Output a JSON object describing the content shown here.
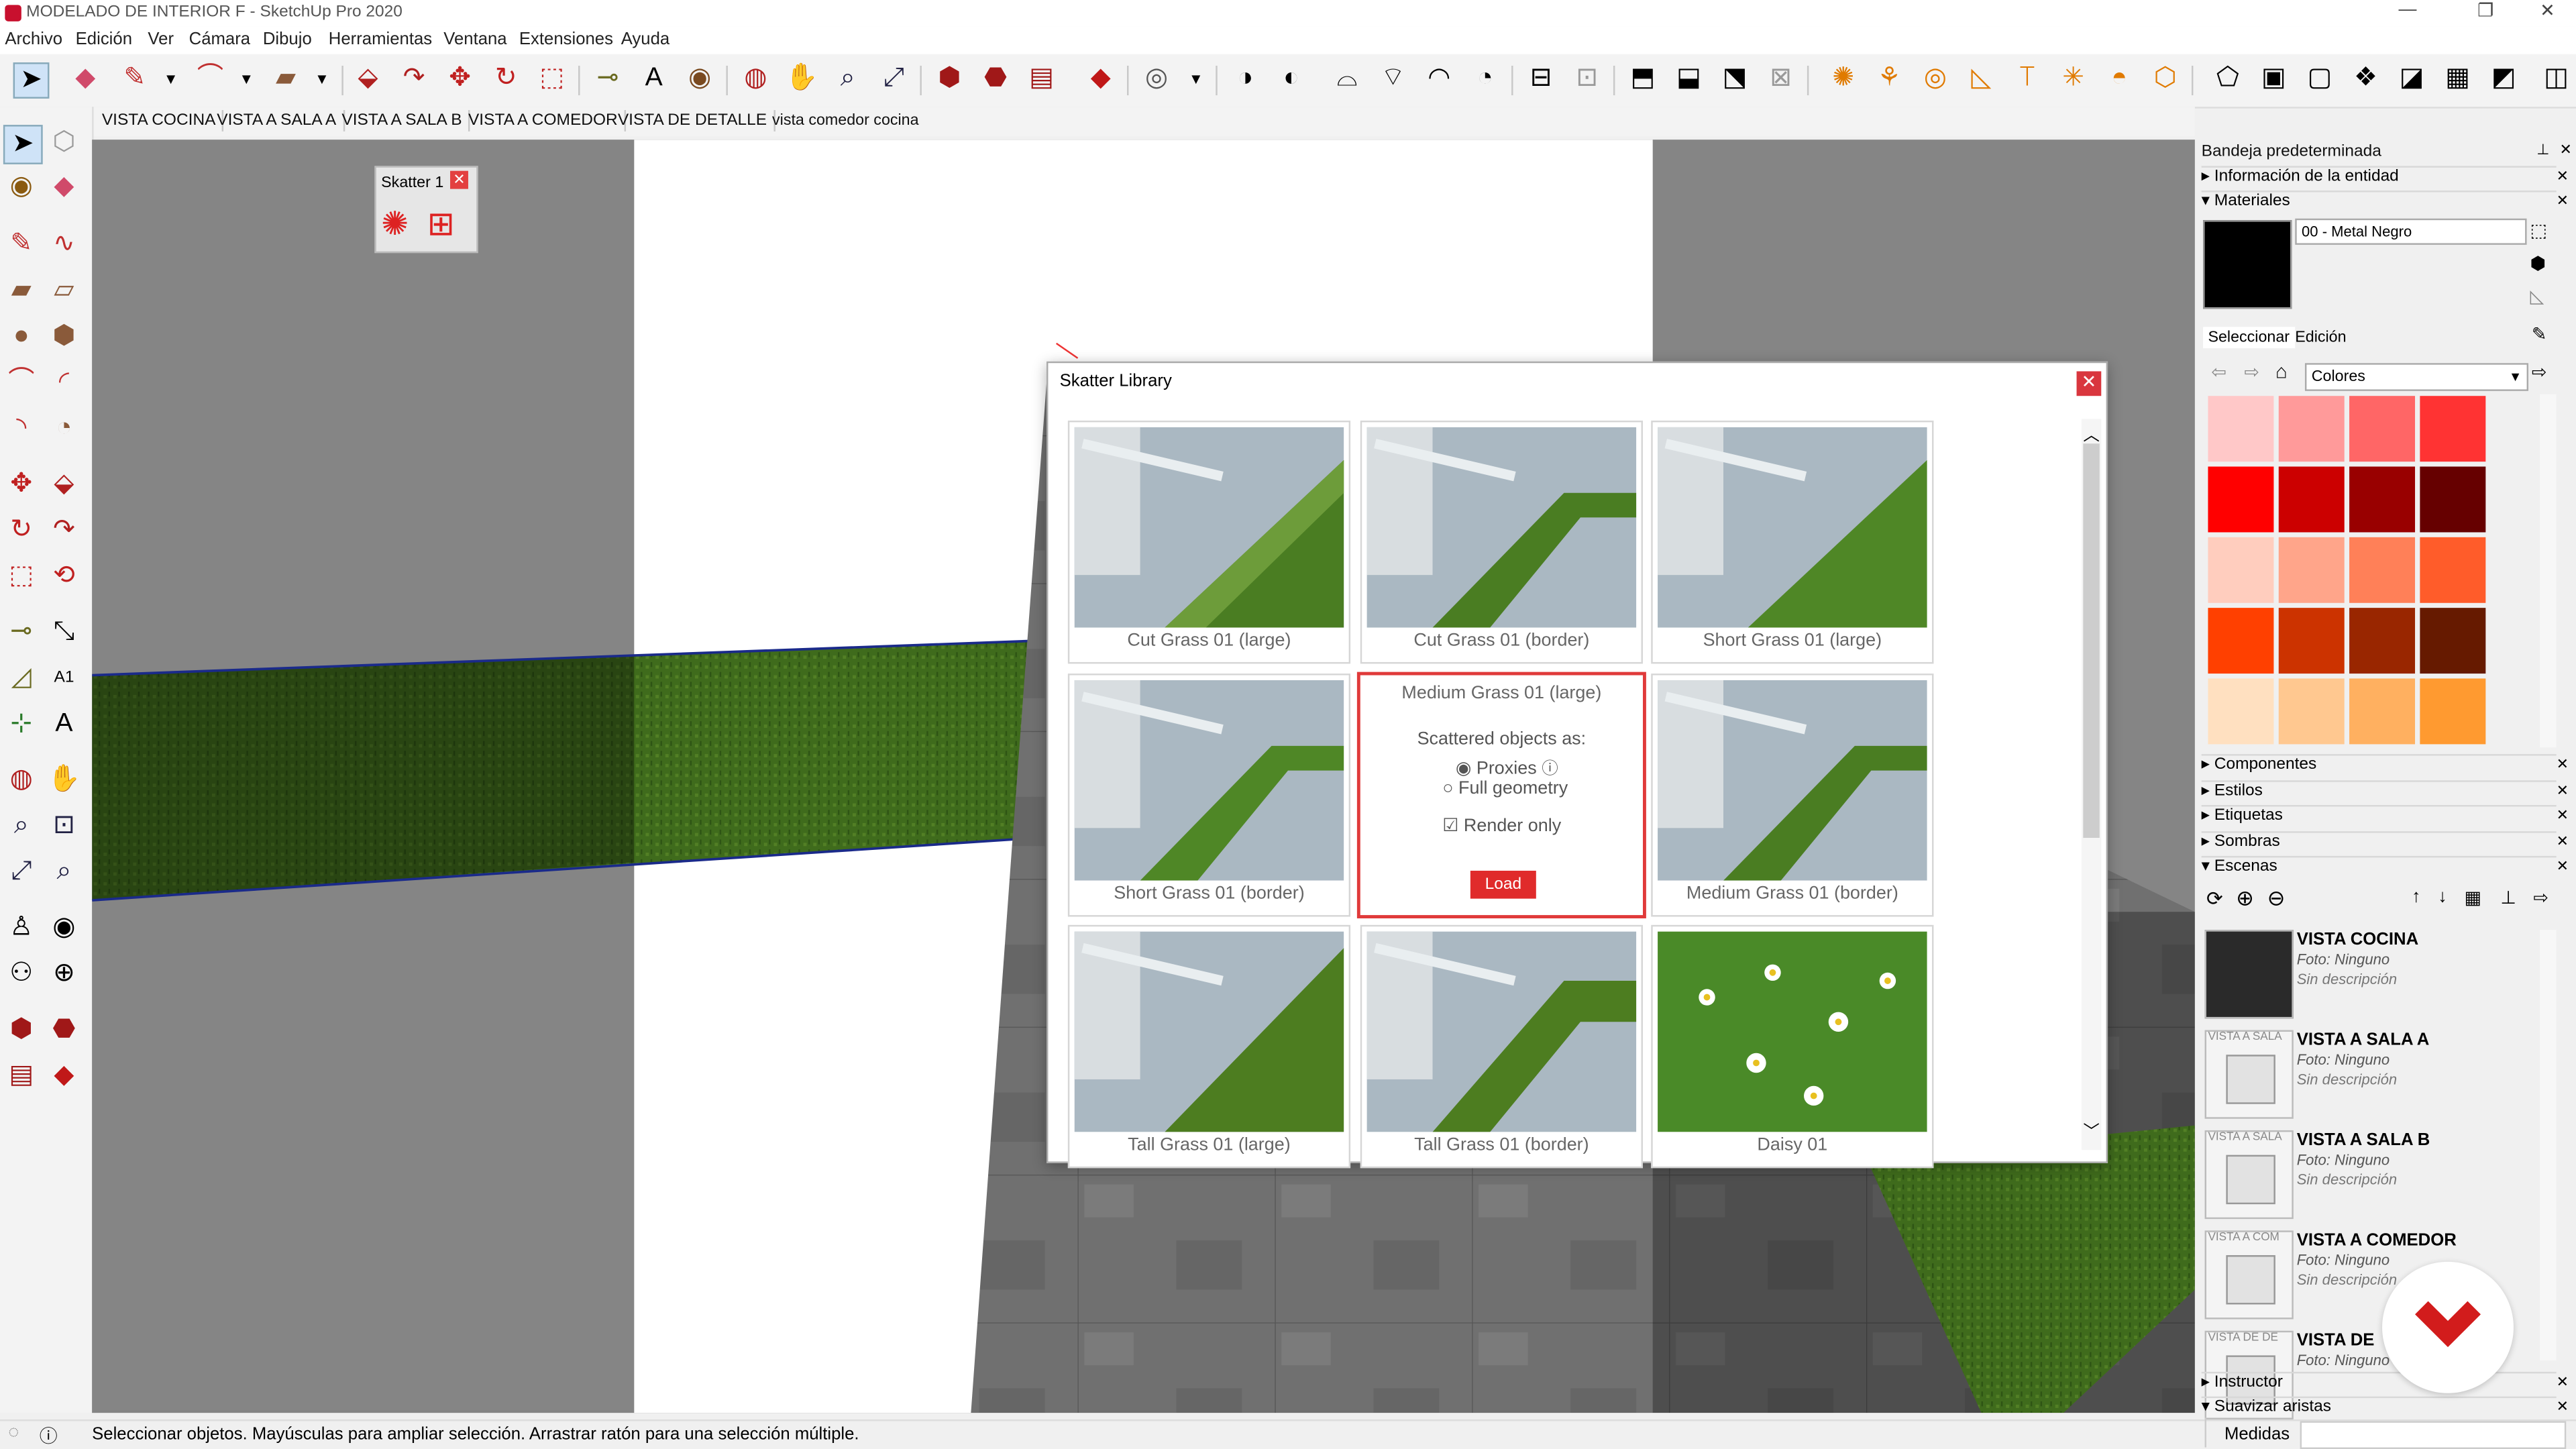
{
  "window": {
    "title": "MODELADO DE INTERIOR F - SketchUp Pro 2020",
    "controls": [
      "—",
      "❐",
      "✕"
    ]
  },
  "menu": [
    "Archivo",
    "Edición",
    "Ver",
    "Cámara",
    "Dibujo",
    "Herramientas",
    "Ventana",
    "Extensiones",
    "Ayuda"
  ],
  "scene_tabs": [
    "VISTA COCINA",
    "VISTA A SALA A",
    "VISTA A SALA B",
    "VISTA A COMEDOR",
    "VISTA DE DETALLE",
    "vista comedor cocina"
  ],
  "scatter_mini": {
    "title": "Skatter 1"
  },
  "dialog": {
    "title": "Skatter Library",
    "items": [
      {
        "name": "Cut Grass 01 (large)"
      },
      {
        "name": "Cut Grass 01 (border)"
      },
      {
        "name": "Short Grass 01 (large)"
      },
      {
        "name": "Short Grass 01 (border)"
      },
      {
        "name": "Medium Grass 01 (large)"
      },
      {
        "name": "Medium Grass 01 (border)"
      },
      {
        "name": "Tall Grass 01 (large)"
      },
      {
        "name": "Tall Grass 01 (border)"
      },
      {
        "name": "Daisy 01"
      }
    ],
    "selected": {
      "name": "Medium Grass 01 (large)",
      "scattered_label": "Scattered objects as:",
      "opt_proxies": "Proxies",
      "opt_full": "Full geometry",
      "render_only": "Render only",
      "load": "Load"
    }
  },
  "tray": {
    "title": "Bandeja predeterminada",
    "entity_info": "Información de la entidad",
    "materials": "Materiales",
    "material_name": "00 - Metal Negro",
    "tab_select": "Seleccionar",
    "tab_edit": "Edición",
    "library": "Colores",
    "swatches": [
      "#ffc8c8",
      "#ff9a9a",
      "#ff6666",
      "#ff3333",
      "#ff0000",
      "#cc0000",
      "#990000",
      "#660000",
      "#ffcdbe",
      "#ffa58a",
      "#ff8058",
      "#ff5c2a",
      "#ff4000",
      "#cc3300",
      "#992600",
      "#661a00",
      "#ffe0c0",
      "#ffc890",
      "#ffb060",
      "#ff9a30"
    ],
    "sections": [
      "Componentes",
      "Estilos",
      "Etiquetas",
      "Sombras",
      "Escenas"
    ],
    "scenes": [
      {
        "name": "VISTA COCINA",
        "foto": "Foto: Ninguno",
        "desc": "Sin descripción",
        "thumb": ""
      },
      {
        "name": "VISTA A SALA A",
        "foto": "Foto: Ninguno",
        "desc": "Sin descripción",
        "thumb": "VISTA A SALA"
      },
      {
        "name": "VISTA A SALA B",
        "foto": "Foto: Ninguno",
        "desc": "Sin descripción",
        "thumb": "VISTA A SALA"
      },
      {
        "name": "VISTA A COMEDOR",
        "foto": "Foto: Ninguno",
        "desc": "Sin descripción",
        "thumb": "VISTA A COM"
      },
      {
        "name": "VISTA DE",
        "foto": "Foto: Ninguno",
        "desc": "",
        "thumb": "VISTA DE DE"
      }
    ],
    "instructor": "Instructor",
    "suavizar": "Suavizar aristas"
  },
  "status": {
    "text": "Seleccionar objetos. Mayúsculas para ampliar selección. Arrastrar ratón para una selección múltiple.",
    "medidas": "Medidas"
  }
}
